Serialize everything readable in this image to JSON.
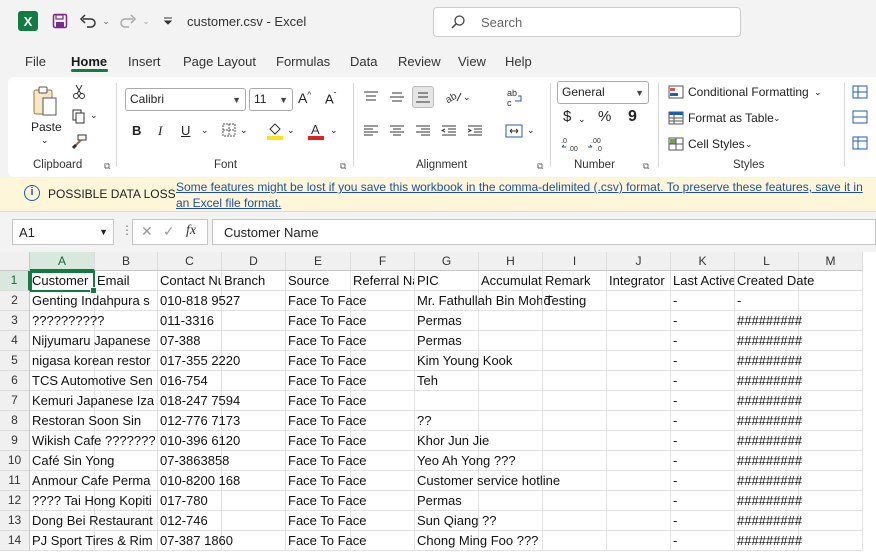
{
  "window": {
    "app_icon_letter": "X",
    "file_name": "customer.csv",
    "app_name": "Excel",
    "title_separator": " - ",
    "search_placeholder": "Search"
  },
  "menu": [
    "File",
    "Home",
    "Insert",
    "Page Layout",
    "Formulas",
    "Data",
    "Review",
    "View",
    "Help"
  ],
  "active_menu": "Home",
  "ribbon": {
    "clipboard": {
      "paste_label": "Paste",
      "group_label": "Clipboard"
    },
    "font": {
      "font_name": "Calibri",
      "font_size": "11",
      "group_label": "Font"
    },
    "alignment": {
      "group_label": "Alignment"
    },
    "number": {
      "format": "General",
      "group_label": "Number",
      "currency": "$",
      "percent": "%",
      "comma": "9"
    },
    "styles": {
      "conditional": "Conditional Formatting",
      "format_table": "Format as Table",
      "cell_styles": "Cell Styles",
      "group_label": "Styles"
    }
  },
  "message_bar": {
    "title": "POSSIBLE DATA LOSS",
    "text": "Some features might be lost if you save this workbook in the comma-delimited (.csv) format. To preserve these features, save it in an Excel file format."
  },
  "formula_bar": {
    "name_box": "A1",
    "fx_label": "fx",
    "formula": "Customer Name"
  },
  "colors": {
    "excel_green": "#107c41",
    "warning_bg": "#fdf6d8",
    "link_blue": "#1f4fa8"
  },
  "sheet": {
    "columns": [
      "A",
      "B",
      "C",
      "D",
      "E",
      "F",
      "G",
      "H",
      "I",
      "J",
      "K",
      "L",
      "M"
    ],
    "row_numbers": [
      "1",
      "2",
      "3",
      "4",
      "5",
      "6",
      "7",
      "8",
      "9",
      "10",
      "11",
      "12",
      "13",
      "14"
    ],
    "rows": [
      [
        "Customer Name",
        "Email",
        "Contact Number",
        "Branch",
        "Source",
        "Referral Name",
        "PIC",
        "Accumulated",
        "Remark",
        "Integrator",
        "Last Active",
        "Created Date",
        ""
      ],
      [
        "Genting Indahpura s",
        "",
        "010-818 9527",
        "",
        "Face To Face",
        "",
        "Mr. Fathullah Bin Mohd",
        "",
        "Testing",
        "",
        "-",
        "-",
        ""
      ],
      [
        "??????????",
        "",
        "011-3316",
        "",
        "Face To Face",
        "",
        "Permas",
        "",
        "",
        "",
        "-",
        "#########",
        ""
      ],
      [
        "Nijyumaru Japanese",
        "",
        "07-388",
        "",
        "Face To Face",
        "",
        "Permas",
        "",
        "",
        "",
        "-",
        "#########",
        ""
      ],
      [
        "nigasa korean restor",
        "",
        "017-355 2220",
        "",
        "Face To Face",
        "",
        "Kim Young Kook",
        "",
        "",
        "",
        "-",
        "#########",
        ""
      ],
      [
        "TCS Automotive Sen",
        "",
        "016-754",
        "",
        "Face To Face",
        "",
        "Teh",
        "",
        "",
        "",
        "-",
        "#########",
        ""
      ],
      [
        "Kemuri Japanese Iza",
        "",
        "018-247 7594",
        "",
        "Face To Face",
        "",
        "",
        "",
        "",
        "",
        "-",
        "#########",
        ""
      ],
      [
        "Restoran Soon Sin",
        "",
        "012-776 7173",
        "",
        "Face To Face",
        "",
        "??",
        "",
        "",
        "",
        "-",
        "#########",
        ""
      ],
      [
        "Wikish Cafe ???????",
        "",
        "010-396 6120",
        "",
        "Face To Face",
        "",
        "Khor Jun Jie",
        "",
        "",
        "",
        "-",
        "#########",
        ""
      ],
      [
        "Café Sin Yong",
        "",
        "07-3863858",
        "",
        "Face To Face",
        "",
        "Yeo Ah Yong ???",
        "",
        "",
        "",
        "-",
        "#########",
        ""
      ],
      [
        "Anmour Cafe Perma",
        "",
        "010-8200 168",
        "",
        "Face To Face",
        "",
        "Customer service hotline",
        "",
        "",
        "",
        "-",
        "#########",
        ""
      ],
      [
        "???? Tai Hong Kopiti",
        "",
        "017-780",
        "",
        "Face To Face",
        "",
        "Permas",
        "",
        "",
        "",
        "-",
        "#########",
        ""
      ],
      [
        "Dong Bei Restaurant",
        "",
        "012-746",
        "",
        "Face To Face",
        "",
        "Sun Qiang ??",
        "",
        "",
        "",
        "-",
        "#########",
        ""
      ],
      [
        "PJ Sport Tires & Rim",
        "",
        "07-387 1860",
        "",
        "Face To Face",
        "",
        "Chong Ming Foo ???",
        "",
        "",
        "",
        "-",
        "#########",
        ""
      ]
    ]
  }
}
